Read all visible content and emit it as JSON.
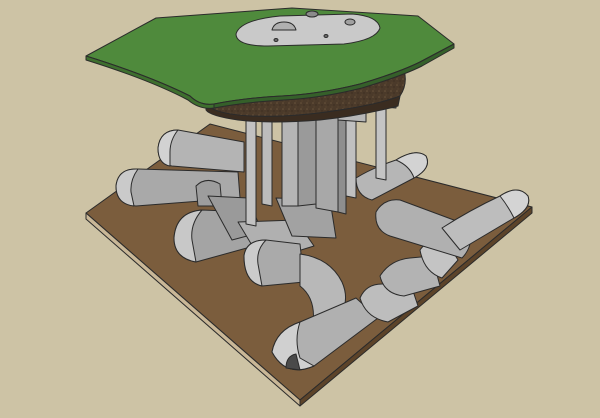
{
  "scene": {
    "colors": {
      "background": "#cdc3a5",
      "base_top": "#7b5d3d",
      "base_edge_light": "#c9b797",
      "base_edge_dark": "#5c4329",
      "tunnel_light": "#c6c6c6",
      "tunnel_mid": "#a9a9a9",
      "tunnel_dark": "#8c8c8c",
      "pillar_light": "#c9c9c9",
      "pillar_dark": "#9a9a9a",
      "grass": "#4f8a3c",
      "grass_edge": "#3e6f2e",
      "earth": "#4b3a2a",
      "cap": "#b7b7b7"
    },
    "components": [
      "base-slab",
      "tunnel-network",
      "support-pillars",
      "earth-layer",
      "grass-cover",
      "surface-platform"
    ]
  }
}
